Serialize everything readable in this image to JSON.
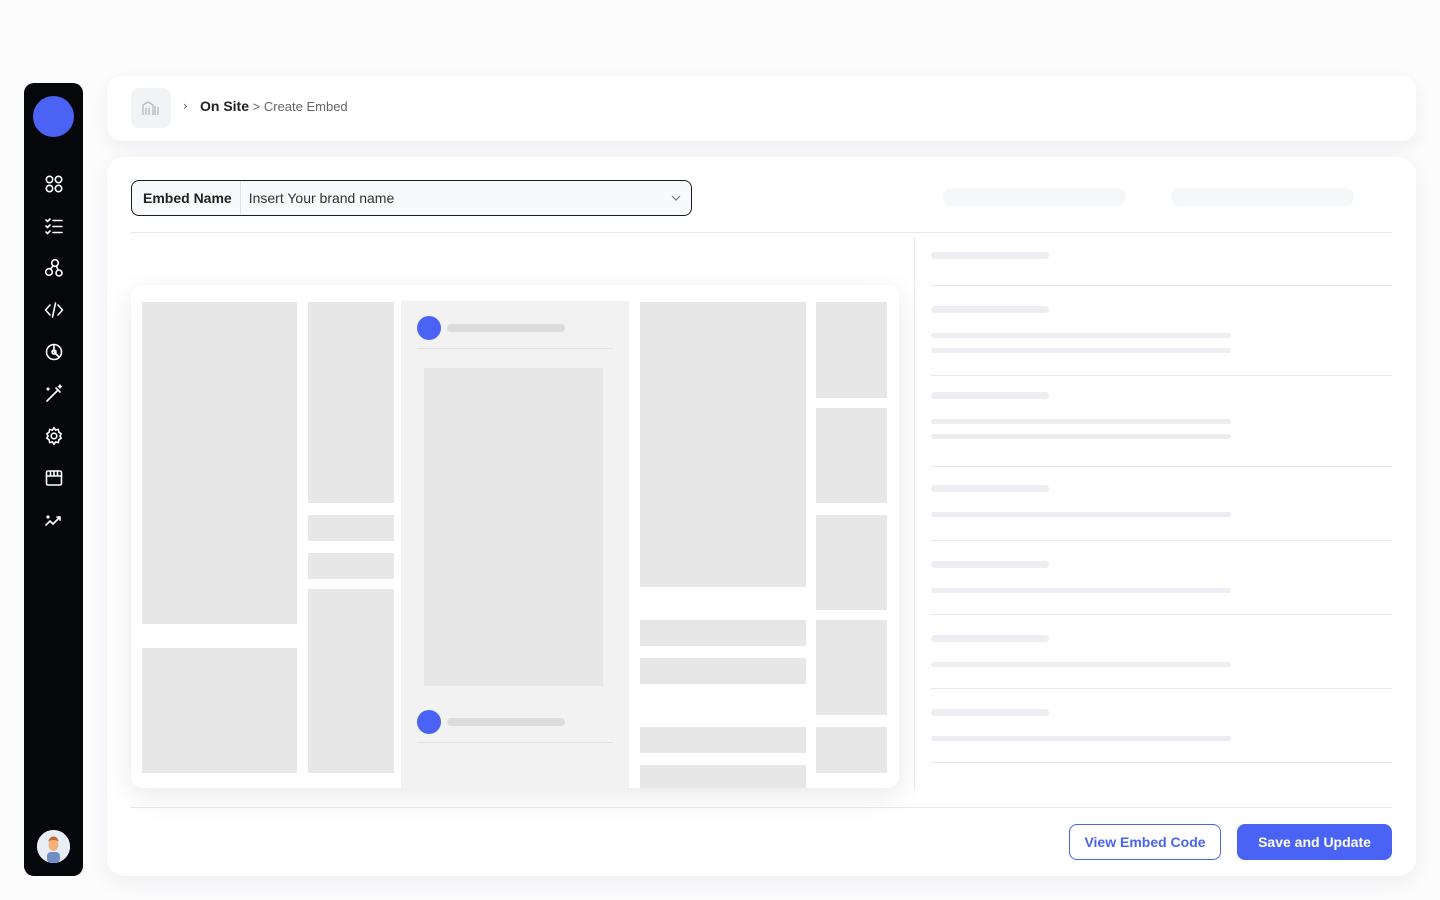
{
  "sidebar": {
    "icons": [
      "grid-icon",
      "checklist-icon",
      "integrations-icon",
      "code-icon",
      "analytics-icon",
      "magic-wand-icon",
      "settings-icon",
      "store-icon",
      "trend-icon"
    ]
  },
  "breadcrumb": {
    "separator": "›",
    "current": "On Site",
    "page": " > Create Embed"
  },
  "embed": {
    "label": "Embed Name",
    "placeholder": "Insert Your brand name"
  },
  "buttons": {
    "view_code": "View Embed Code",
    "save": "Save and Update"
  },
  "colors": {
    "accent": "#4a63f5",
    "sidebar_bg": "#06070b",
    "placeholder_block": "#e7e7e7"
  }
}
